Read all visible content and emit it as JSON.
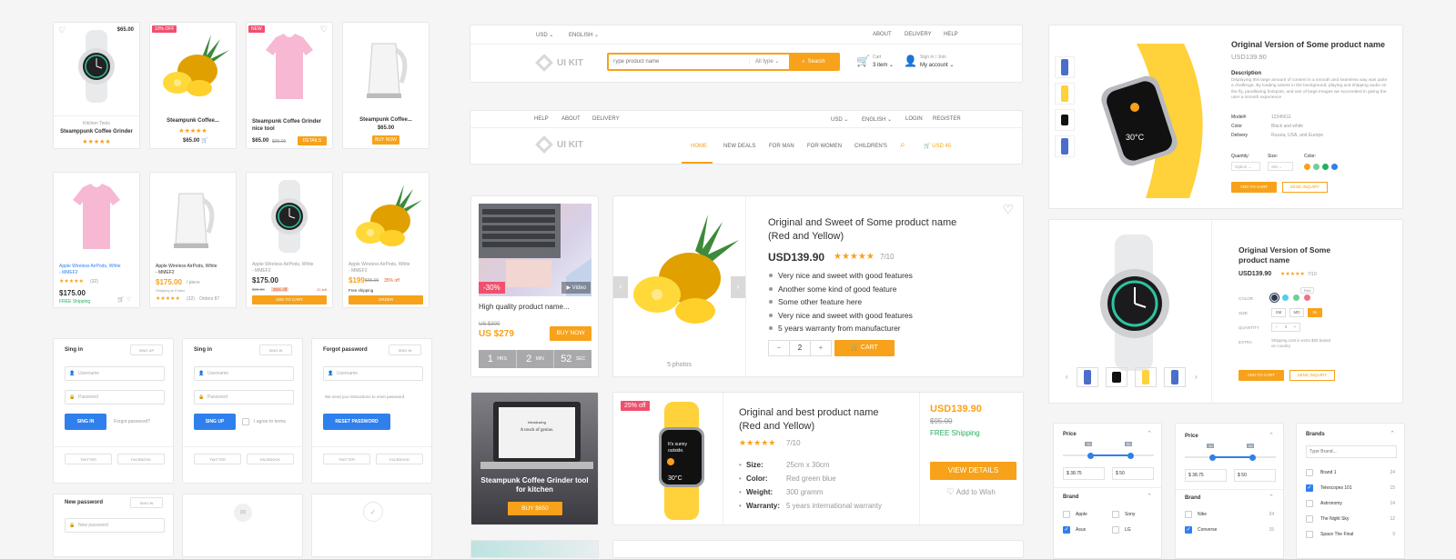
{
  "cards_row1": [
    {
      "price": "$65.00",
      "cat": "Kitchen Tools",
      "name": "Steamppunk Coffee Grinder",
      "stars": "★★★★★"
    },
    {
      "badge": "10% OFF",
      "name": "Steampunk Coffee...",
      "stars": "★★★★★",
      "price": "$65.00",
      "cart": "🛒"
    },
    {
      "badge": "NEW",
      "name": "Steampunk Coffee Grinder nice tool",
      "price": "$65.00",
      "old": "$95.00",
      "btn": "DETAILS"
    },
    {
      "name": "Steampunk Coffee...",
      "price": "$65.00",
      "btn": "BUY NOW"
    }
  ],
  "cards_row2": [
    {
      "name": "Apple Wireless AirPods, White - MMEF2",
      "stars": "★★★★★",
      "reviews": "(32)",
      "price": "$175.00",
      "ship": "FREE Shipping"
    },
    {
      "name": "Apple Wireless AirPods, White - MMEF2",
      "price": "$175.00",
      "unit": "/ piece",
      "ship": "Shipping to Fedex",
      "stars": "★★★★★",
      "reviews": "(32)",
      "orders": "Orders 87"
    },
    {
      "name": "Apple Wireless AirPods, White - MMEF2",
      "price": "$175.00",
      "old": "$95.00",
      "off": "35% off",
      "left": "21 left",
      "btn": "ADD TO CART"
    },
    {
      "name": "Apple Wireless AirPods, White - MMEF2",
      "price": "$199",
      "old": "$95.00",
      "off": "35% off",
      "ship": "Free shipping",
      "btn": "ORDER"
    }
  ],
  "auth": [
    {
      "title": "Sing in",
      "tab": "SING UP",
      "f1": "Username",
      "f2": "Password",
      "btn": "SING IN",
      "link": "Forgot password?",
      "s1": "TWITTER",
      "s2": "FACEBOOK"
    },
    {
      "title": "Sing in",
      "tab": "SING IN",
      "f1": "Username",
      "f2": "Password",
      "btn": "SING UP",
      "link": "I agree to terms",
      "s1": "TWITTER",
      "s2": "FACEBOOK"
    },
    {
      "title": "Forgot password",
      "tab": "SING IN",
      "f1": "Username",
      "note": "We send you Instructions to reset password",
      "btn": "RESET PASSWORD",
      "s1": "TWITTER",
      "s2": "FACEBOOK"
    }
  ],
  "newpass": {
    "title": "New password",
    "tab": "SING IN",
    "f1": "New password"
  },
  "header1": {
    "currency": "USD",
    "lang": "ENGLISH",
    "links": [
      "ABOUT",
      "DELIVERY",
      "HELP"
    ],
    "logo": "UI KIT",
    "search_placeholder": "Type product name",
    "type": "All type",
    "search": "Search",
    "cart_label": "Cart",
    "cart_items": "3 item",
    "signin": "Sign in / Join",
    "account": "My account"
  },
  "header2": {
    "links": [
      "HELP",
      "ABOUT",
      "DELIVERY"
    ],
    "currency": "USD",
    "lang": "ENGLISH",
    "login": "LOGIN",
    "register": "REGISTER",
    "logo": "UI KIT",
    "nav": [
      "HOME",
      "NEW DEALS",
      "FOR MAN",
      "FOR WOMEN",
      "CHILDREN'S"
    ],
    "cart": "USD 45"
  },
  "deal": {
    "off": "-30%",
    "video": "Video",
    "name": "High quality product name...",
    "old": "US $300",
    "price": "US $279",
    "btn": "BUY NOW",
    "timer": [
      {
        "n": "1",
        "u": "HRS"
      },
      {
        "n": "2",
        "u": "MIN"
      },
      {
        "n": "52",
        "u": "SEC"
      }
    ]
  },
  "product_big": {
    "title": "Original and Sweet of Some product name (Red and Yellow)",
    "price": "USD139.90",
    "stars": "★★★★★",
    "rating": "7/10",
    "features": [
      "Very nice and sweet with good features",
      "Another some kind of good feature",
      "Some other feature here",
      "Very nice and sweet with good features",
      "5 years warranty from manufacturer"
    ],
    "photos": "5 photos",
    "qty": "2",
    "cart": "CART"
  },
  "promo": {
    "title": "Steampunk Coffee Grinder tool for kitchen",
    "btn": "BUY $650",
    "screen": "Introducing\nA touch of genius."
  },
  "product_list": {
    "badge": "25% off",
    "title": "Original and best product name (Red and Yellow)",
    "stars": "★★★★★",
    "rating": "7/10",
    "specs": [
      {
        "k": "Size:",
        "v": "25cm x 30cm"
      },
      {
        "k": "Color:",
        "v": "Red green blue"
      },
      {
        "k": "Weight:",
        "v": "300 gramm"
      },
      {
        "k": "Warranty:",
        "v": "5 years international warranty"
      }
    ],
    "price": "USD139.90",
    "old": "$95.00",
    "ship": "FREE Shipping",
    "btn": "VIEW DETAILS",
    "wish": "Add to Wish",
    "watch": "It's sunny outside.",
    "temp": "30°C"
  },
  "detail1": {
    "title": "Original Version of Some product name",
    "price": "USD139.90",
    "desc_label": "Description",
    "desc": "Displaying this large amount of content in a smooth and seamless way was quite a challenge. By loading assets in the background, playing and shipping audio on the fly, parallaxing hotspots, and use of large images we succeeded in giving the user a smooth experience",
    "rows": [
      {
        "k": "Model#",
        "v": "12345611"
      },
      {
        "k": "Color",
        "v": "Black and white"
      },
      {
        "k": "Delivery",
        "v": "Russia, USA, and Europe"
      }
    ],
    "qty_label": "Quantity:",
    "qty": "Option",
    "size_label": "Size:",
    "size": "SM",
    "color_label": "Color:",
    "add": "ADD TO CART",
    "inquiry": "SEND INQUIRY",
    "colors": [
      "#f7a21a",
      "#6fcf97",
      "#27ae60",
      "#2f80ed"
    ]
  },
  "detail2": {
    "title": "Original Version of Some product name",
    "price": "USD139.90",
    "stars": "★★★★★",
    "rating": "7/10",
    "color_label": "COLOR",
    "size_label": "SIZE",
    "qty_label": "QUANTITY",
    "extra_label": "EXTRA",
    "extra": "Shipping cost is extra $25 based on country",
    "sizes": [
      "SM",
      "MD",
      "XL"
    ],
    "tooltip": "Red",
    "qty": "2",
    "add": "ADD TO CART",
    "inquiry": "SEND INQUIRY",
    "colors": [
      "#2b3a55",
      "#56ccf2",
      "#6fcf97",
      "#f0708a"
    ]
  },
  "filter1": {
    "price": "Price",
    "min": "$ 38.75",
    "max": "$ 50",
    "h1": "10",
    "h2": "50",
    "brand": "Brand",
    "brands": [
      {
        "n": "Apple",
        "on": false
      },
      {
        "n": "Sony",
        "on": false
      },
      {
        "n": "Asus",
        "on": true
      },
      {
        "n": "LG",
        "on": false
      }
    ]
  },
  "filter2": {
    "price": "Price",
    "min": "$ 38.75",
    "max": "$ 50",
    "h1": "10",
    "h2": "50",
    "brand": "Brand",
    "brands": [
      {
        "n": "Nike",
        "c": "24",
        "on": false
      },
      {
        "n": "Converse",
        "c": "15",
        "on": true
      }
    ]
  },
  "filter3": {
    "title": "Brands",
    "placeholder": "Type Brand...",
    "items": [
      {
        "n": "Brand 1",
        "c": "24",
        "on": false
      },
      {
        "n": "Telescopes 101",
        "c": "15",
        "on": true
      },
      {
        "n": "Astronomy",
        "c": "14",
        "on": false
      },
      {
        "n": "The Night Sky",
        "c": "12",
        "on": false
      },
      {
        "n": "Space The Final",
        "c": "9",
        "on": false
      }
    ]
  }
}
